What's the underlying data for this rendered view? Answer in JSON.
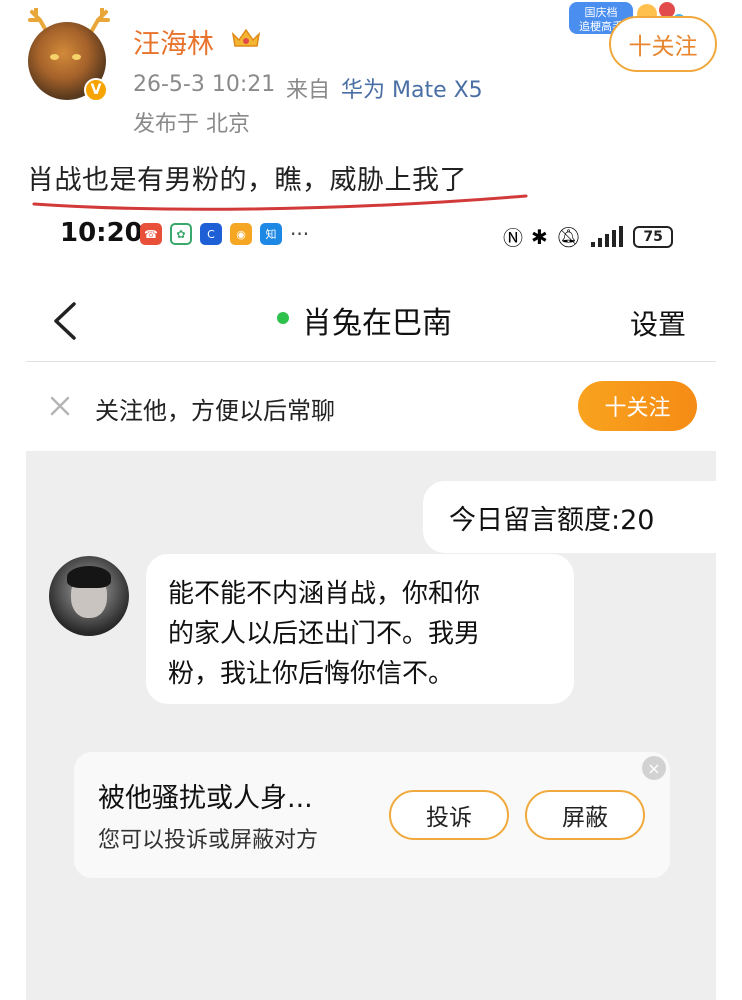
{
  "post": {
    "author_name": "汪海林",
    "time": "26-5-3 10:21",
    "source_label": "来自",
    "device": "华为 Mate X5",
    "location": "发布于 北京",
    "follow_label": "十关注",
    "event_badge_line1": "国庆档",
    "event_badge_line2": "追梗高手",
    "text": "肖战也是有男粉的，瞧，威胁上我了",
    "underline_color": "#d23a3a"
  },
  "phone": {
    "status": {
      "time": "10:20",
      "more_dots": "···",
      "battery": "75",
      "app_icons": [
        "missed-call-icon",
        "clover-icon",
        "c-icon",
        "weibo-icon",
        "zhihu-icon"
      ]
    },
    "nav": {
      "title": "肖兔在巴南",
      "settings": "设置",
      "online_color": "#2ec24c"
    },
    "follow_bar": {
      "hint": "关注他，方便以后常聊",
      "button": "十关注"
    },
    "chat": {
      "quota": "今日留言额度:20",
      "message_lines": [
        "能不能不内涵肖战，你和你",
        "的家人以后还出门不。我男",
        "粉，我让你后悔你信不。"
      ]
    },
    "report_card": {
      "title": "被他骚扰或人身...",
      "desc": "您可以投诉或屏蔽对方",
      "complain": "投诉",
      "block": "屏蔽"
    }
  },
  "colors": {
    "accent_orange": "#f58b15",
    "name_orange": "#e8732d",
    "link_blue": "#4a6fa5"
  }
}
